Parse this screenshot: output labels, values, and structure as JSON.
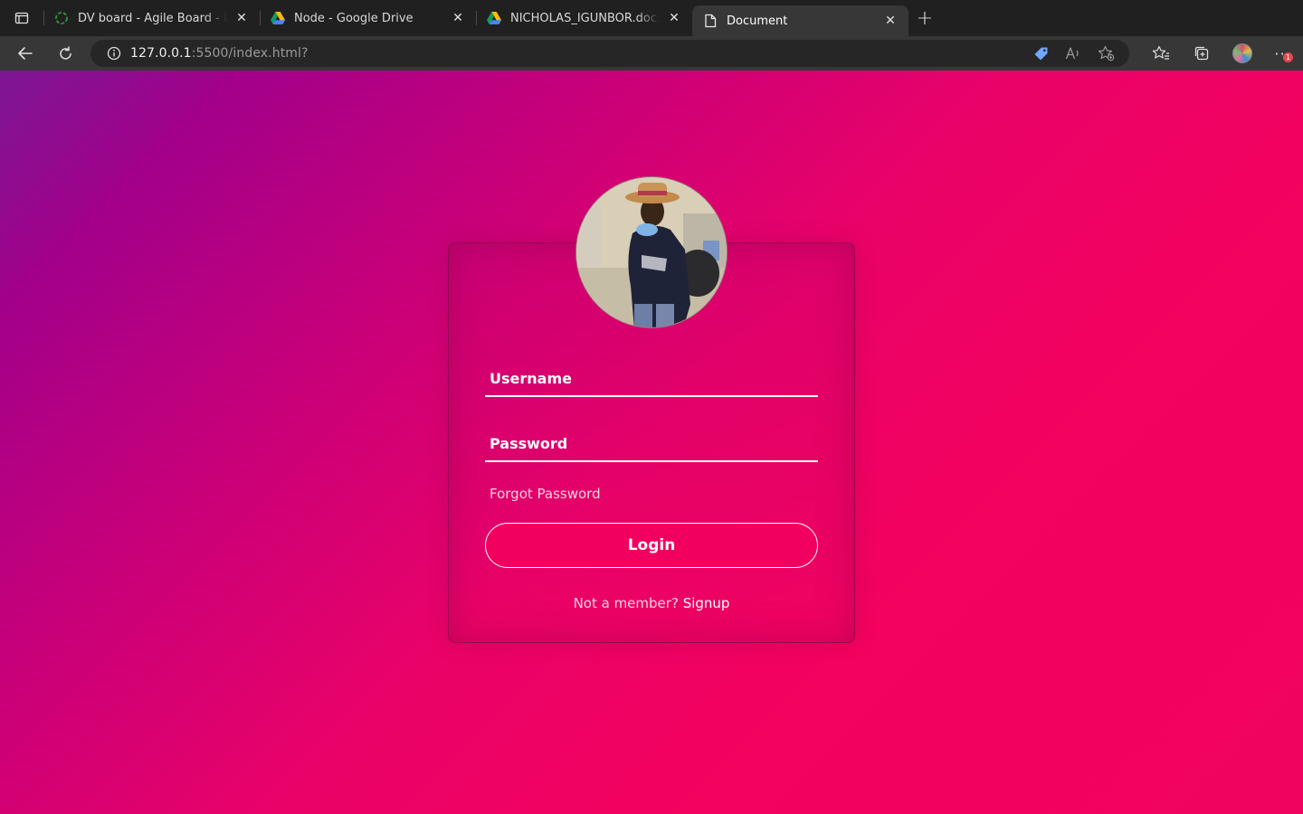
{
  "browser": {
    "tabs": [
      {
        "title": "DV board - Agile Board - Decagon",
        "favicon": "agile-board-favicon",
        "active": false
      },
      {
        "title": "Node - Google Drive",
        "favicon": "google-drive-icon",
        "active": false
      },
      {
        "title": "NICHOLAS_IGUNBOR.docx - Google Drive",
        "favicon": "google-drive-icon",
        "active": false
      },
      {
        "title": "Document",
        "favicon": "document-icon",
        "active": true
      }
    ],
    "address": {
      "host": "127.0.0.1",
      "rest": ":5500/index.html?"
    },
    "notification_count": "1"
  },
  "login": {
    "username_placeholder": "Username",
    "password_placeholder": "Password",
    "forgot_label": "Forgot Password",
    "login_label": "Login",
    "signup_prompt": "Not a member?",
    "signup_label": "Signup"
  },
  "colors": {
    "gradient_start": "#7c1794",
    "gradient_end": "#f3025f",
    "button_bg": "#f2005f"
  }
}
